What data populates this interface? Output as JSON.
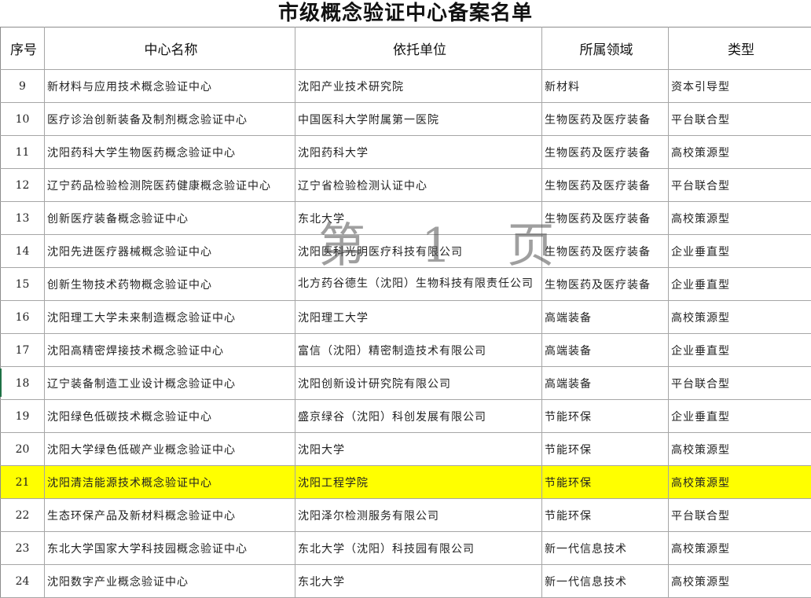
{
  "title": "市级概念验证中心备案名单",
  "watermark": "第 1 页",
  "headers": {
    "seq": "序号",
    "name": "中心名称",
    "org": "依托单位",
    "field": "所属领域",
    "type": "类型"
  },
  "rows": [
    {
      "seq": "9",
      "name": "新材料与应用技术概念验证中心",
      "org": "沈阳产业技术研究院",
      "field": "新材料",
      "type": "资本引导型"
    },
    {
      "seq": "10",
      "name": "医疗诊治创新装备及制剂概念验证中心",
      "org": "中国医科大学附属第一医院",
      "field": "生物医药及医疗装备",
      "type": "平台联合型"
    },
    {
      "seq": "11",
      "name": "沈阳药科大学生物医药概念验证中心",
      "org": "沈阳药科大学",
      "field": "生物医药及医疗装备",
      "type": "高校策源型"
    },
    {
      "seq": "12",
      "name": "辽宁药品检验检测院医药健康概念验证中心",
      "org": "辽宁省检验检测认证中心",
      "field": "生物医药及医疗装备",
      "type": "平台联合型"
    },
    {
      "seq": "13",
      "name": "创新医疗装备概念验证中心",
      "org": "东北大学",
      "field": "生物医药及医疗装备",
      "type": "高校策源型"
    },
    {
      "seq": "14",
      "name": "沈阳先进医疗器械概念验证中心",
      "org": "沈阳医科光明医疗科技有限公司",
      "field": "生物医药及医疗装备",
      "type": "企业垂直型"
    },
    {
      "seq": "15",
      "name": "创新生物技术药物概念验证中心",
      "org": "北方药谷德生（沈阳）生物科技有限责任公司",
      "field": "生物医药及医疗装备",
      "type": "企业垂直型"
    },
    {
      "seq": "16",
      "name": "沈阳理工大学未来制造概念验证中心",
      "org": "沈阳理工大学",
      "field": "高端装备",
      "type": "高校策源型"
    },
    {
      "seq": "17",
      "name": "沈阳高精密焊接技术概念验证中心",
      "org": "富信（沈阳）精密制造技术有限公司",
      "field": "高端装备",
      "type": "企业垂直型"
    },
    {
      "seq": "18",
      "name": "辽宁装备制造工业设计概念验证中心",
      "org": "沈阳创新设计研究院有限公司",
      "field": "高端装备",
      "type": "平台联合型"
    },
    {
      "seq": "19",
      "name": "沈阳绿色低碳技术概念验证中心",
      "org": "盛京绿谷（沈阳）科创发展有限公司",
      "field": "节能环保",
      "type": "企业垂直型"
    },
    {
      "seq": "20",
      "name": "沈阳大学绿色低碳产业概念验证中心",
      "org": "沈阳大学",
      "field": "节能环保",
      "type": "高校策源型"
    },
    {
      "seq": "21",
      "name": "沈阳清洁能源技术概念验证中心",
      "org": "沈阳工程学院",
      "field": "节能环保",
      "type": "高校策源型"
    },
    {
      "seq": "22",
      "name": "生态环保产品及新材料概念验证中心",
      "org": "沈阳泽尔检测服务有限公司",
      "field": "节能环保",
      "type": "平台联合型"
    },
    {
      "seq": "23",
      "name": "东北大学国家大学科技园概念验证中心",
      "org": "东北大学（沈阳）科技园有限公司",
      "field": "新一代信息技术",
      "type": "高校策源型"
    },
    {
      "seq": "24",
      "name": "沈阳数字产业概念验证中心",
      "org": "东北大学",
      "field": "新一代信息技术",
      "type": "高校策源型"
    }
  ],
  "colors": {
    "highlight_row": "#ffff00",
    "grid_line": "#a6a6a6",
    "row_marker": "#1e7145"
  }
}
